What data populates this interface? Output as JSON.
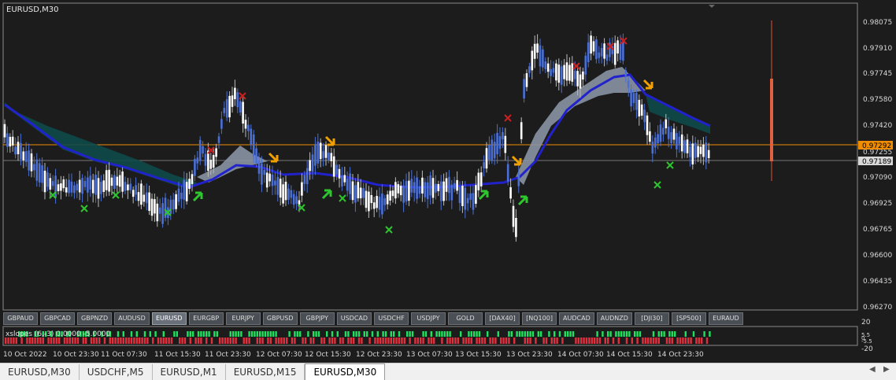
{
  "window_title": "EURUSD,M30",
  "price_axis": {
    "labels": [
      "0.98075",
      "0.97910",
      "0.97745",
      "0.97580",
      "0.97420",
      "0.97255",
      "0.97090",
      "0.96925",
      "0.96765",
      "0.96600",
      "0.96435",
      "0.96270"
    ],
    "current_bid": "0.97292",
    "current_ask": "0.97189",
    "bid_color": "#f08c00"
  },
  "indicator_axis": {
    "labels": [
      "20",
      "5.5",
      "0",
      "-5.5",
      "-20"
    ]
  },
  "indicator_label": "xslopes (6,-3) 0.0000 -5.0000",
  "time_axis": {
    "labels": [
      "10 Oct 2022",
      "10 Oct 23:30",
      "11 Oct 07:30",
      "11 Oct 15:30",
      "11 Oct 23:30",
      "12 Oct 07:30",
      "12 Oct 15:30",
      "12 Oct 23:30",
      "13 Oct 07:30",
      "13 Oct 15:30",
      "13 Oct 23:30",
      "14 Oct 07:30",
      "14 Oct 15:30",
      "14 Oct 23:30"
    ]
  },
  "symbols": [
    "GBPAUD",
    "GBPCAD",
    "GBPNZD",
    "AUDUSD",
    "EURUSD",
    "EURGBP",
    "EURJPY",
    "GBPUSD",
    "GBPJPY",
    "USDCAD",
    "USDCHF",
    "USDJPY",
    "GOLD",
    "[DAX40]",
    "[NQ100]",
    "AUDCAD",
    "AUDNZD",
    "[DJI30]",
    "[SP500]",
    "EURAUD"
  ],
  "active_symbol": "EURUSD",
  "tabs": [
    "EURUSD,M30",
    "USDCHF,M5",
    "EURUSD,M1",
    "EURUSD,M15",
    "EURUSD,M30"
  ],
  "active_tab_index": 4,
  "colors": {
    "background": "#1c1c1c",
    "bull_candle": "#ffffff",
    "bear_candle": "#4a70d8",
    "ma_band": "#2222cc",
    "cloud": "#0e4a4a",
    "grey_cloud": "#8a94a4",
    "buy_arrow": "#2ec52e",
    "sell_arrow": "#f0a000",
    "x_red": "#cc2020",
    "x_green": "#2ec52e",
    "hist_pos": "#20e060",
    "hist_neg": "#e03040"
  }
}
